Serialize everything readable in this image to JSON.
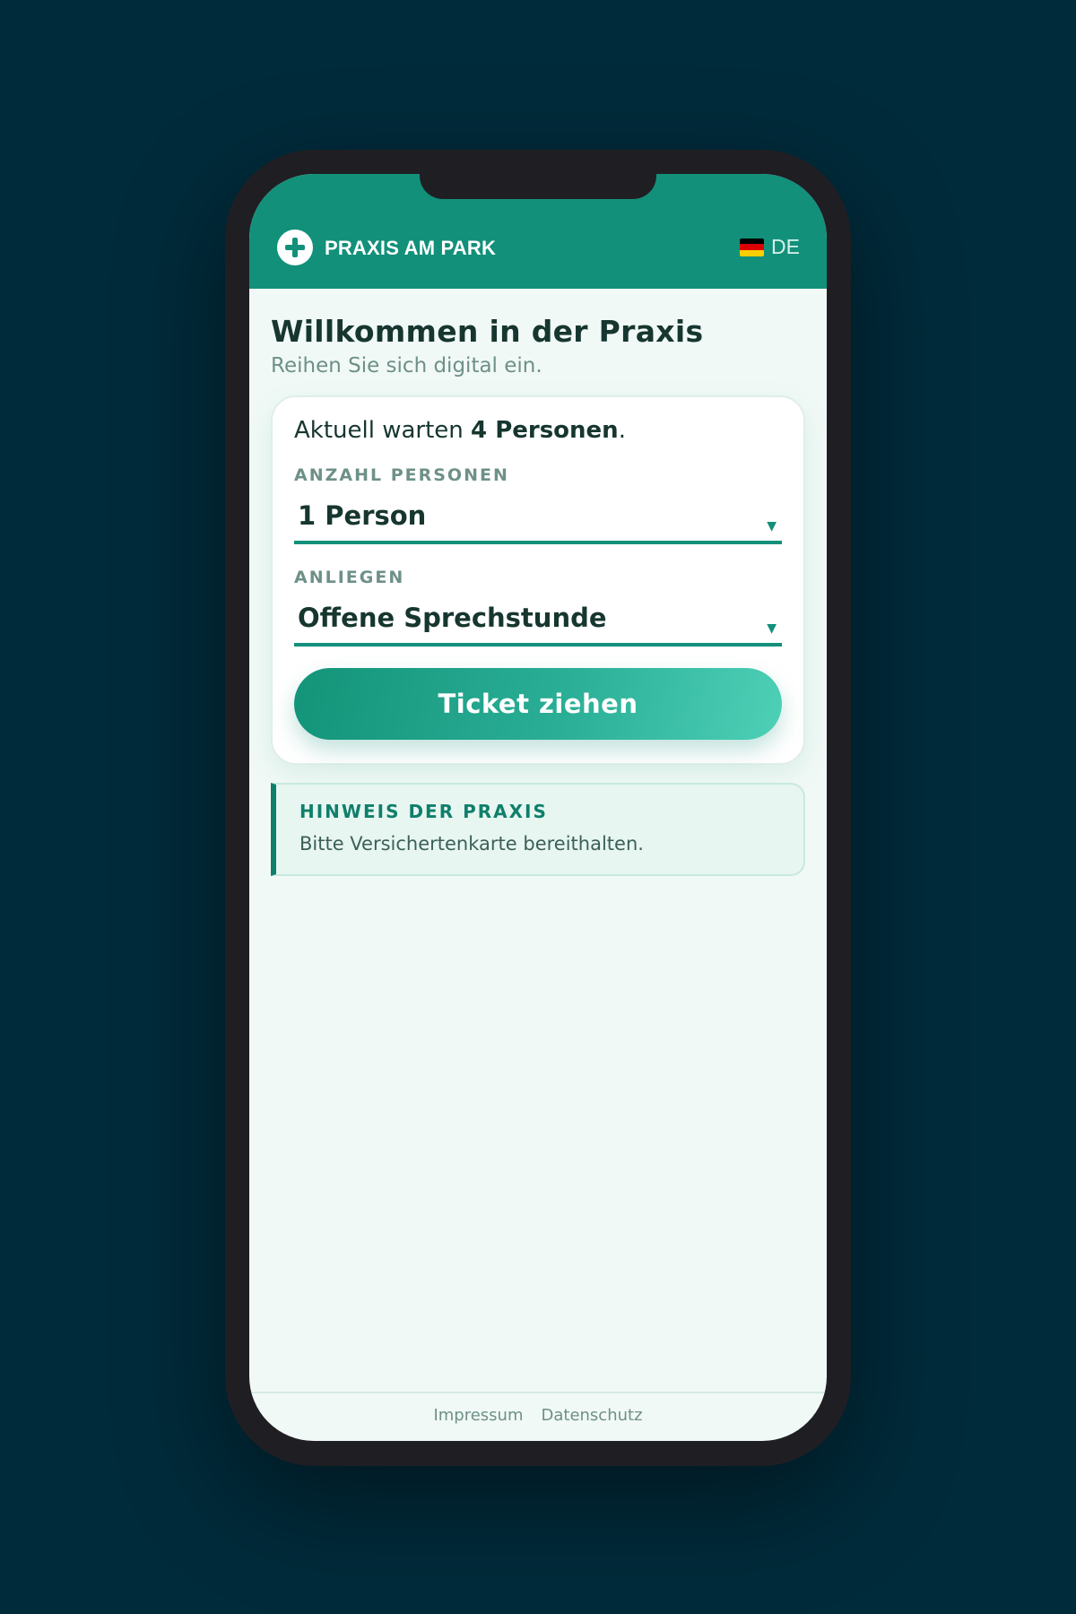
{
  "header": {
    "brand": "PRAXIS AM PARK",
    "language": "DE",
    "flag_colors": [
      "#000000",
      "#dd0000",
      "#ffce00"
    ],
    "accent": "#12907a"
  },
  "main": {
    "title": "Willkommen in der Praxis",
    "subtitle": "Reihen Sie sich digital ein.",
    "waiting_prefix": "Aktuell warten ",
    "waiting_count": "4 Personen",
    "waiting_suffix": ".",
    "persons_label": "ANZAHL PERSONEN",
    "persons_value": "1 Person",
    "concern_label": "ANLIEGEN",
    "concern_value": "Offene Sprechstunde",
    "ticket_button": "Ticket ziehen"
  },
  "notice": {
    "title": "HINWEIS DER PRAXIS",
    "text": "Bitte Versichertenkarte bereithalten."
  },
  "footer": {
    "impressum": "Impressum",
    "datenschutz": "Datenschutz"
  },
  "icons": {
    "logo": "plus-circle-icon",
    "caret": "▼"
  }
}
